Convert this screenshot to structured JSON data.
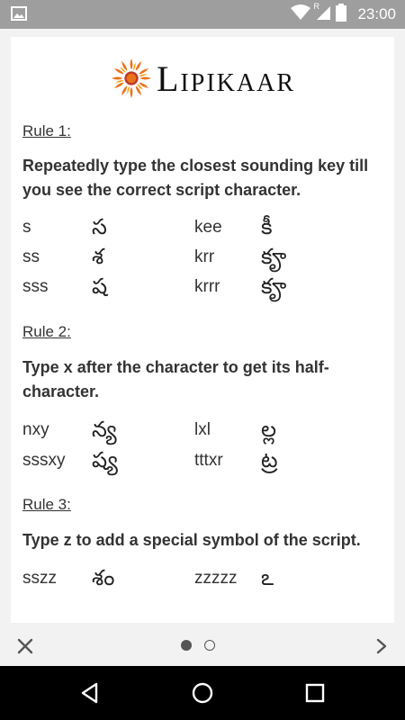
{
  "statusbar": {
    "time": "23:00",
    "icons": [
      "image-icon",
      "wifi-icon",
      "signal-icon",
      "battery-icon"
    ],
    "signal_label": "R"
  },
  "logo": {
    "text": "Lipikaar",
    "icon": "sun-logo-icon"
  },
  "rules": [
    {
      "title": "Rule 1:",
      "description": "Repeatedly type the closest sounding key till you see the correct script character.",
      "rows": [
        {
          "key1": "s",
          "glyph1": "స",
          "key2": "kee",
          "glyph2": "కీ"
        },
        {
          "key1": "ss",
          "glyph1": "శ",
          "key2": "krr",
          "glyph2": "కౄ"
        },
        {
          "key1": "sss",
          "glyph1": "ష",
          "key2": "krrr",
          "glyph2": "కౄ"
        }
      ]
    },
    {
      "title": "Rule 2:",
      "description": "Type x after the character to get its half-character.",
      "rows": [
        {
          "key1": "nxy",
          "glyph1": "న్య",
          "key2": "lxl",
          "glyph2": "ల్ల"
        },
        {
          "key1": "sssxy",
          "glyph1": "ష్య",
          "key2": "tttxr",
          "glyph2": "ట్ర"
        }
      ]
    },
    {
      "title": "Rule 3:",
      "description": "Type z to add a special symbol of the script.",
      "rows": [
        {
          "key1": "sszz",
          "glyph1": "శం",
          "key2": "zzzzz",
          "glyph2": "ఽ"
        }
      ]
    }
  ],
  "pager": {
    "current_page": 1,
    "total_pages": 2
  },
  "colors": {
    "statusbar": "#9e9e9e",
    "card": "#ffffff",
    "background": "#f2f2f2",
    "navbar": "#000000",
    "logo_orange": "#e8731a"
  }
}
